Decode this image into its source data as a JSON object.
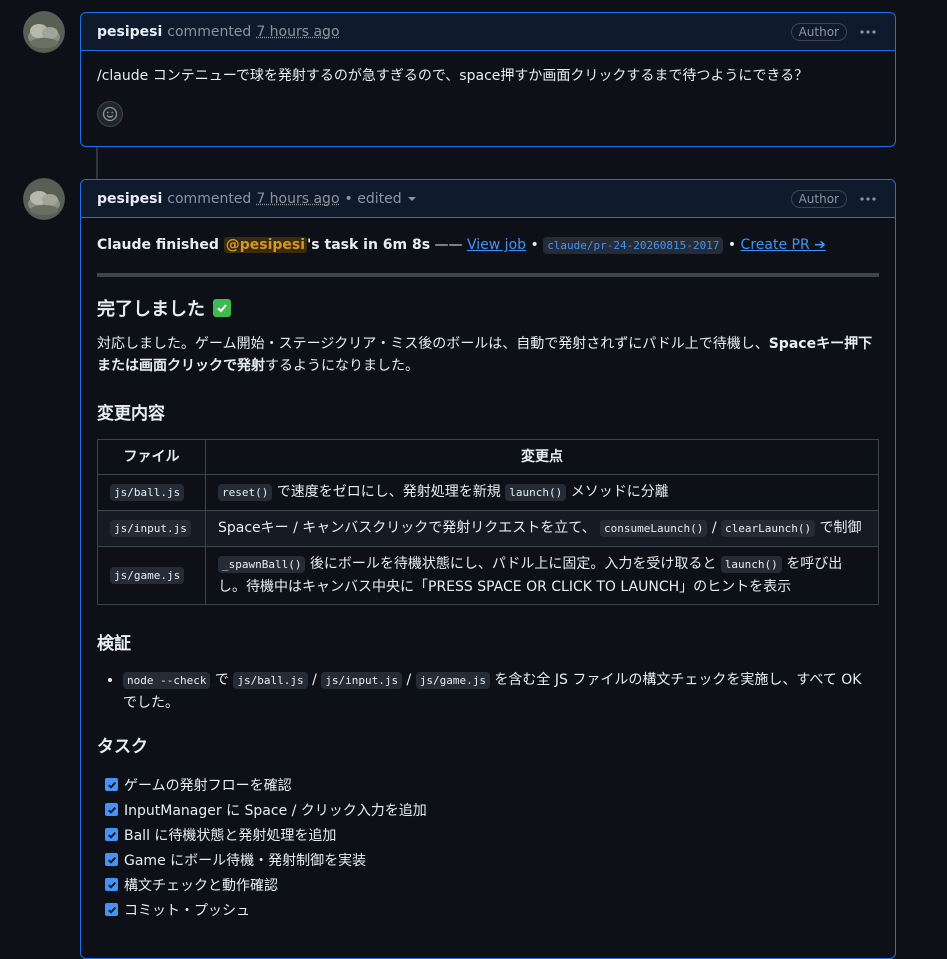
{
  "comment1": {
    "author": "pesipesi",
    "action": "commented",
    "time": "7 hours ago",
    "badge": "Author",
    "body": "/claude コンテニューで球を発射するのが急すぎるので、space押すか画面クリックするまで待つようにできる？"
  },
  "comment2": {
    "author": "pesipesi",
    "action": "commented",
    "time": "7 hours ago",
    "edited": "• edited",
    "badge": "Author",
    "status": {
      "prefix": "Claude finished ",
      "mention": "@pesipesi",
      "suffix": "'s task in 6m 8s",
      "dash": " —— ",
      "view_job": "View job",
      "sep": " • ",
      "branch": "claude/pr-24-20260815-2017",
      "create_pr": "Create PR ➔"
    },
    "title": "完了しました",
    "summary_a": "対応しました。ゲーム開始・ステージクリア・ミス後のボールは、自動で発射されずにパドル上で待機し、",
    "summary_b": "Spaceキー押下または画面クリックで発射",
    "summary_c": "するようになりました。",
    "changes_heading": "変更内容",
    "table": {
      "headers": [
        "ファイル",
        "変更点"
      ],
      "rows": [
        {
          "file": "js/ball.js",
          "parts": [
            {
              "code": "reset()"
            },
            {
              "text": " で速度をゼロにし、発射処理を新規 "
            },
            {
              "code": "launch()"
            },
            {
              "text": " メソッドに分離"
            }
          ]
        },
        {
          "file": "js/input.js",
          "parts": [
            {
              "text": "Spaceキー / キャンバスクリックで発射リクエストを立て、 "
            },
            {
              "code": "consumeLaunch()"
            },
            {
              "text": " / "
            },
            {
              "code": "clearLaunch()"
            },
            {
              "text": " で制御"
            }
          ]
        },
        {
          "file": "js/game.js",
          "parts": [
            {
              "code": "_spawnBall()"
            },
            {
              "text": " 後にボールを待機状態にし、パドル上に固定。入力を受け取ると "
            },
            {
              "code": "launch()"
            },
            {
              "text": " を呼び出し。待機中はキャンバス中央に「PRESS SPACE OR CLICK TO LAUNCH」のヒントを表示"
            }
          ]
        }
      ]
    },
    "verify_heading": "検証",
    "verify_item": [
      {
        "code": "node --check"
      },
      {
        "text": " で "
      },
      {
        "code": "js/ball.js"
      },
      {
        "text": " / "
      },
      {
        "code": "js/input.js"
      },
      {
        "text": " / "
      },
      {
        "code": "js/game.js"
      },
      {
        "text": " を含む全 JS ファイルの構文チェックを実施し、すべて OK でした。"
      }
    ],
    "tasks_heading": "タスク",
    "tasks": [
      "ゲームの発射フローを確認",
      "InputManager に Space / クリック入力を追加",
      "Ball に待機状態と発射処理を追加",
      "Game にボール待機・発射制御を実装",
      "構文チェックと動作確認",
      "コミット・プッシュ"
    ]
  },
  "colors": {
    "accent": "#1f6feb",
    "link": "#4493f8",
    "check": "#3fb950"
  }
}
